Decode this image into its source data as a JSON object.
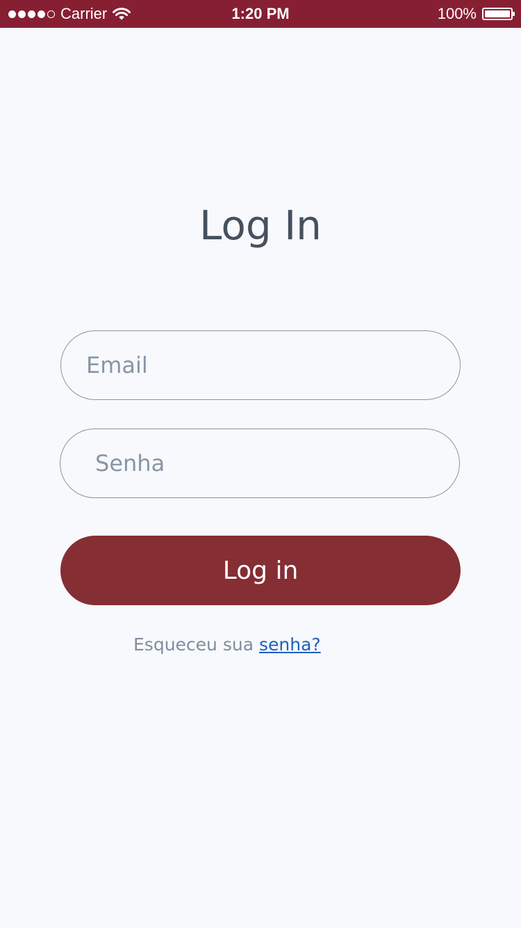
{
  "status_bar": {
    "carrier": "Carrier",
    "time": "1:20 PM",
    "battery_percent": "100%",
    "signal_bars_filled": 4,
    "signal_bars_total": 5,
    "battery_level": 1.0,
    "icons": [
      "signal-dots-icon",
      "wifi-icon",
      "battery-icon"
    ]
  },
  "login": {
    "title": "Log In",
    "email_placeholder": "Email",
    "password_placeholder": "Senha",
    "submit_label": "Log in",
    "forgot_prefix": "Esqueceu sua",
    "forgot_link": "senha?"
  },
  "colors": {
    "status_bar_bg": "#871f33",
    "page_bg": "#f7f9fc",
    "button_bg": "#852e34",
    "title_text": "#46505e",
    "placeholder_text": "#8895a6",
    "link": "#1f5fbf"
  }
}
